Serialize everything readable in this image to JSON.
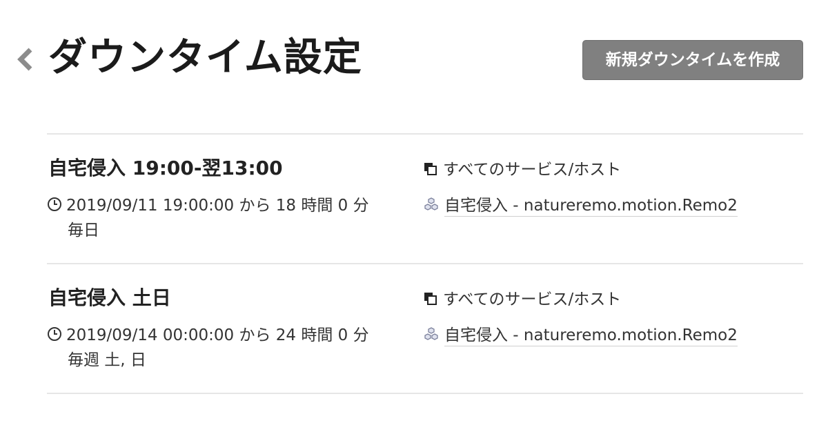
{
  "header": {
    "title": "ダウンタイム設定",
    "create_button_label": "新規ダウンタイムを作成"
  },
  "downtimes": [
    {
      "name": "自宅侵入 19:00-翌13:00",
      "period": "2019/09/11 19:00:00 から 18 時間 0 分",
      "recurrence": "毎日",
      "scope": "すべてのサービス/ホスト",
      "monitor": "自宅侵入 - natureremo.motion.Remo2"
    },
    {
      "name": "自宅侵入 土日",
      "period": "2019/09/14 00:00:00 から 24 時間 0 分",
      "recurrence": "毎週 土, 日",
      "scope": "すべてのサービス/ホスト",
      "monitor": "自宅侵入 - natureremo.motion.Remo2"
    }
  ],
  "colors": {
    "button_bg": "#808080",
    "divider": "#e6e6e6",
    "text": "#222222",
    "icon_gray": "#8a8fa8"
  }
}
